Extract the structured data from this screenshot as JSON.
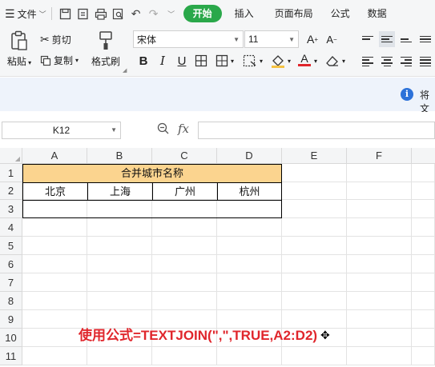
{
  "menubar": {
    "file_label": "文件",
    "tabs": [
      "开始",
      "插入",
      "页面布局",
      "公式",
      "数据"
    ]
  },
  "ribbon": {
    "paste_label": "粘贴",
    "cut_label": "剪切",
    "copy_label": "复制",
    "format_painter_label": "格式刷",
    "font_name": "宋体",
    "font_size": "11"
  },
  "notice": {
    "text": "将文"
  },
  "formula_bar": {
    "name_box": "K12",
    "fx_label": "fx",
    "formula": ""
  },
  "sheet": {
    "columns": [
      "A",
      "B",
      "C",
      "D",
      "E",
      "F"
    ],
    "rows": [
      "1",
      "2",
      "3",
      "4",
      "5",
      "6",
      "7",
      "8",
      "9",
      "10",
      "11"
    ],
    "title_cell": "合并城市名称",
    "cities": [
      "北京",
      "上海",
      "广州",
      "杭州"
    ],
    "header_fill_color": "#fbd48f"
  },
  "overlay_caption": "使用公式=TEXTJOIN(\",\",TRUE,A2:D2)",
  "colors": {
    "accent_tab": "#2aa84a",
    "caption": "#e0262c",
    "info": "#2d72d9"
  }
}
